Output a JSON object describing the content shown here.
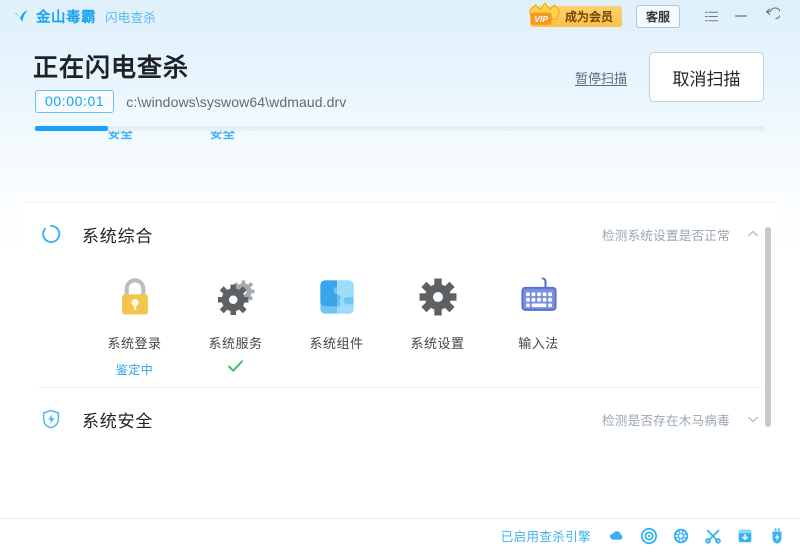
{
  "titlebar": {
    "brand_name": "金山毒霸",
    "brand_sub": "闪电查杀",
    "vip_label": "成为会员",
    "vip_badge_text": "VIP",
    "support_label": "客服",
    "menu_icon": "menu-icon",
    "minimize_icon": "minimize-icon",
    "restore_icon": "restore-icon"
  },
  "hero": {
    "title": "正在闪电查杀",
    "pause_label": "暂停扫描",
    "cancel_label": "取消扫描",
    "timer": "00:00:01",
    "scan_path": "c:\\windows\\syswow64\\wdmaud.drv"
  },
  "progress": {
    "percent": 10,
    "clipped_labels": [
      {
        "text": "安全",
        "left_pct": 10
      },
      {
        "text": "安全",
        "left_pct": 24
      }
    ]
  },
  "sections": [
    {
      "id": "system-overview",
      "icon": "spinner-icon",
      "title": "系统综合",
      "hint": "检测系统设置是否正常",
      "chevron": "chevron-up-icon",
      "items": [
        {
          "icon": "lock-icon",
          "label": "系统登录",
          "state": "鉴定中",
          "check": false
        },
        {
          "icon": "gears-icon",
          "label": "系统服务",
          "state": "",
          "check": true
        },
        {
          "icon": "puzzle-icon",
          "label": "系统组件",
          "state": "",
          "check": false
        },
        {
          "icon": "gear-icon",
          "label": "系统设置",
          "state": "",
          "check": false
        },
        {
          "icon": "keyboard-icon",
          "label": "输入法",
          "state": "",
          "check": false
        }
      ]
    },
    {
      "id": "system-security",
      "icon": "shield-bolt-icon",
      "title": "系统安全",
      "hint": "检测是否存在木马病毒",
      "chevron": "chevron-down-icon",
      "items": []
    }
  ],
  "footer": {
    "status_text": "已启用查杀引擎",
    "icons": [
      "cloud-icon",
      "spiral-engine-icon",
      "virus-globe-icon",
      "tools-icon",
      "archive-icon",
      "usb-shield-icon"
    ]
  },
  "colors": {
    "accent": "#17a2f5",
    "brand": "#1aa3f0",
    "vip": "#ffc04a",
    "ok_green": "#36c06a",
    "text_dark": "#1d2129",
    "text_muted": "#9aa6b2"
  }
}
